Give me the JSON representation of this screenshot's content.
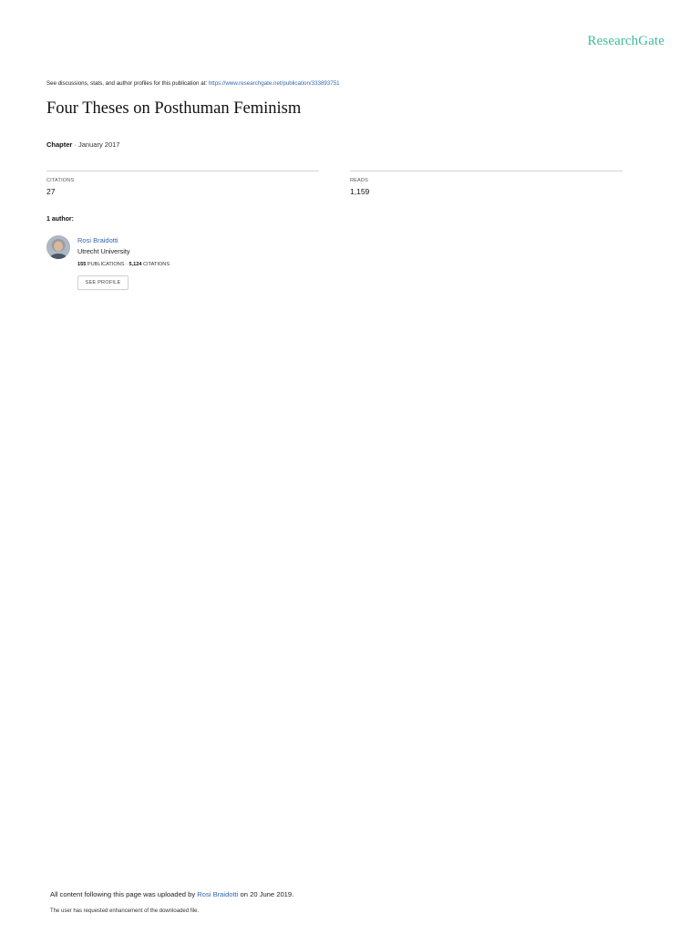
{
  "brand": {
    "logo_text": "ResearchGate",
    "accent_color": "#40ba9b",
    "link_color": "#3366b0"
  },
  "header": {
    "discussion_text": "See discussions, stats, and author profiles for this publication at: ",
    "publication_url": "https://www.researchgate.net/publication/333893751"
  },
  "publication": {
    "title": "Four Theses on Posthuman Feminism",
    "type": "Chapter",
    "separator": " · ",
    "date": "January 2017"
  },
  "stats": {
    "citations": {
      "label": "CITATIONS",
      "value": "27"
    },
    "reads": {
      "label": "READS",
      "value": "1,159"
    }
  },
  "authors": {
    "heading": "1 author:",
    "list": [
      {
        "name": "Rosi Braidotti",
        "institution": "Utrecht University",
        "publications_count": "155",
        "publications_label": " PUBLICATIONS",
        "stats_separator": " · ",
        "citations_count": "5,124",
        "citations_label": " CITATIONS",
        "profile_button": "SEE PROFILE",
        "avatar_icon": "author-photo-icon"
      }
    ]
  },
  "footer": {
    "upload_prefix": "All content following this page was uploaded by ",
    "uploader": "Rosi Braidotti",
    "upload_suffix": " on 20 June 2019.",
    "note": "The user has requested enhancement of the downloaded file."
  }
}
